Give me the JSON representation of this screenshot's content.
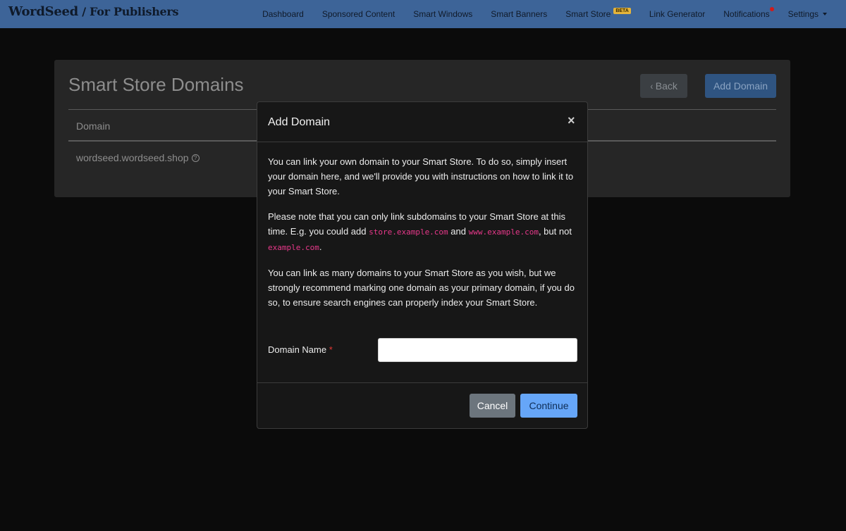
{
  "brand": {
    "name": "WordSeed",
    "separator": " / ",
    "sub": "For Publishers"
  },
  "nav": {
    "items": [
      {
        "label": "Dashboard"
      },
      {
        "label": "Sponsored Content"
      },
      {
        "label": "Smart Windows"
      },
      {
        "label": "Smart Banners"
      },
      {
        "label": "Smart Store",
        "badge": "BETA"
      },
      {
        "label": "Link Generator"
      },
      {
        "label": "Notifications",
        "has_dot": true
      },
      {
        "label": "Settings",
        "has_caret": true
      }
    ]
  },
  "page": {
    "title": "Smart Store Domains",
    "back_label": "Back",
    "add_label": "Add Domain",
    "table": {
      "headers": [
        "Domain"
      ],
      "rows": [
        {
          "domain": "wordseed.wordseed.shop"
        }
      ]
    }
  },
  "modal": {
    "title": "Add Domain",
    "close_glyph": "×",
    "paragraphs": {
      "p1": "You can link your own domain to your Smart Store. To do so, simply insert your domain here, and we'll provide you with instructions on how to link it to your Smart Store.",
      "p2_a": "Please note that you can only link subdomains to your Smart Store at this time. E.g. you could add ",
      "p2_code1": "store.example.com",
      "p2_b": " and ",
      "p2_code2": "www.example.com",
      "p2_c": ", but not ",
      "p2_code3": "example.com",
      "p2_d": ".",
      "p3": "You can link as many domains to your Smart Store as you wish, but we strongly recommend marking one domain as your primary domain, if you do so, to ensure search engines can properly index your Smart Store."
    },
    "form": {
      "label": "Domain Name",
      "required_mark": "*",
      "value": "",
      "placeholder": ""
    },
    "cancel_label": "Cancel",
    "continue_label": "Continue"
  },
  "colors": {
    "navbar": "#3d6498",
    "primary": "#66a6f8",
    "secondary": "#6c757d",
    "code": "#e7388a",
    "danger": "#e53935"
  }
}
